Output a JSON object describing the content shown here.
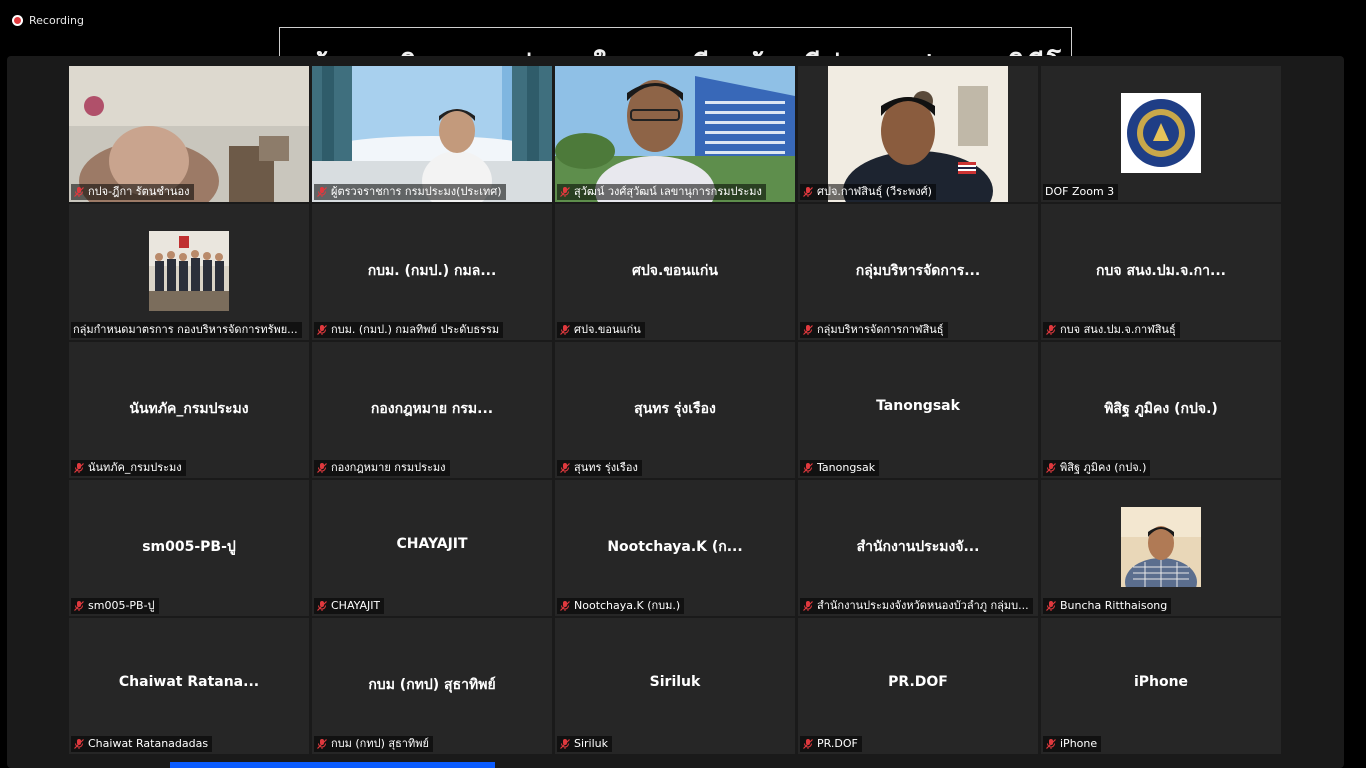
{
  "recording": {
    "label": "Recording"
  },
  "shared_screen": {
    "title_fragment": "ข้อมูลเกินความน่าสนใจและเรียบร้อยดีต่อการประชุมวิดีโอ"
  },
  "tiles": [
    {
      "label": "กปจ-ฎีกา รัตนชำนอง",
      "muted": true,
      "center": ""
    },
    {
      "label": "ผู้ตรวจราชการ กรมประมง(ประเทศ)",
      "muted": true,
      "center": ""
    },
    {
      "label": "สุวัฒน์ วงศ์สุวัฒน์ เลขานุการกรมประมง",
      "muted": true,
      "center": ""
    },
    {
      "label": "ศปจ.กาฬสินธุ์ (วีระพงศ์)",
      "muted": true,
      "center": ""
    },
    {
      "label": "DOF Zoom 3",
      "muted": false,
      "center": ""
    },
    {
      "label": "กลุ่มกำหนดมาตรการ กองบริหารจัดการทรัพย...",
      "muted": false,
      "center": ""
    },
    {
      "label": "กบม. (กมป.) กมลทิพย์ ประดับธรรม",
      "muted": true,
      "center": "กบม. (กมป.) กมล..."
    },
    {
      "label": "ศปจ.ขอนแก่น",
      "muted": true,
      "center": "ศปจ.ขอนแก่น"
    },
    {
      "label": "กลุ่มบริหารจัดการกาฬสินธุ์",
      "muted": true,
      "center": "กลุ่มบริหารจัดการ..."
    },
    {
      "label": "กบจ สนง.ปม.จ.กาฬสินธุ์",
      "muted": true,
      "center": "กบจ สนง.ปม.จ.กา..."
    },
    {
      "label": "นันทภัค_กรมประมง",
      "muted": true,
      "center": "นันทภัค_กรมประมง"
    },
    {
      "label": "กองกฎหมาย กรมประมง",
      "muted": true,
      "center": "กองกฎหมาย กรม..."
    },
    {
      "label": "สุนทร รุ่งเรือง",
      "muted": true,
      "center": "สุนทร รุ่งเรือง"
    },
    {
      "label": "Tanongsak",
      "muted": true,
      "center": "Tanongsak"
    },
    {
      "label": "พิสิฐ ภูมิคง (กปจ.)",
      "muted": true,
      "center": "พิสิฐ ภูมิคง (กปจ.)"
    },
    {
      "label": "sm005-PB-ปู",
      "muted": true,
      "center": "sm005-PB-ปู"
    },
    {
      "label": "CHAYAJIT",
      "muted": true,
      "center": "CHAYAJIT"
    },
    {
      "label": "Nootchaya.K (กบม.)",
      "muted": true,
      "center": "Nootchaya.K  (ก..."
    },
    {
      "label": "สำนักงานประมงจังหวัดหนองบัวลำภู กลุ่มบ...",
      "muted": true,
      "center": "สำนักงานประมงจั..."
    },
    {
      "label": "Buncha Ritthaisong",
      "muted": true,
      "center": ""
    },
    {
      "label": "Chaiwat Ratanadadas",
      "muted": true,
      "center": "Chaiwat  Ratana..."
    },
    {
      "label": "กบม (กทป) สุธาทิพย์",
      "muted": true,
      "center": "กบม (กทป) สุธาทิพย์"
    },
    {
      "label": "Siriluk",
      "muted": true,
      "center": "Siriluk"
    },
    {
      "label": "PR.DOF",
      "muted": true,
      "center": "PR.DOF"
    },
    {
      "label": "iPhone",
      "muted": true,
      "center": "iPhone"
    }
  ],
  "colors": {
    "muted_mic": "#e0393e",
    "tile_bg": "#262626",
    "panel_bg": "#1a1a1a",
    "accent": "#0b5cff"
  }
}
